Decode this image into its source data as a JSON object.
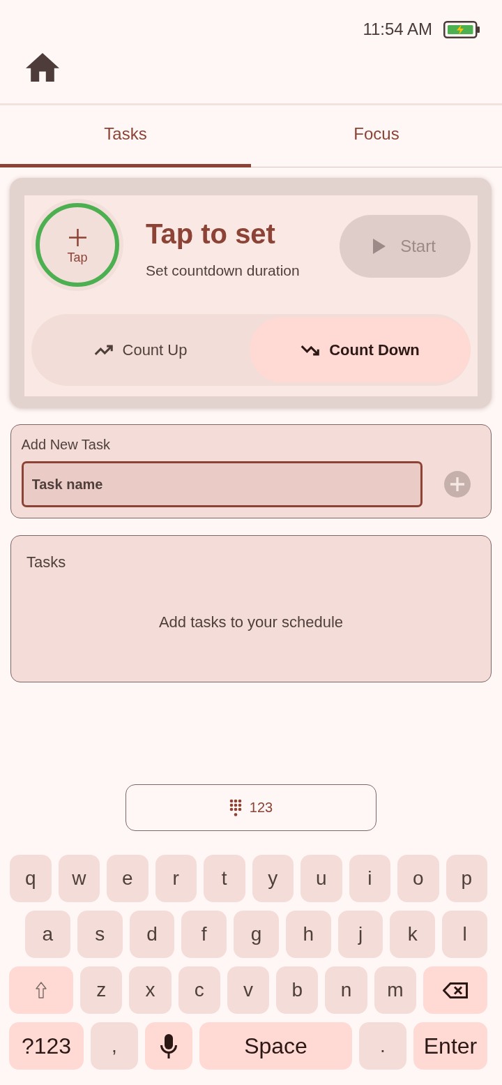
{
  "status_bar": {
    "time": "11:54 AM"
  },
  "tabs": [
    {
      "label": "Tasks",
      "selected": true
    },
    {
      "label": "Focus",
      "selected": false
    }
  ],
  "timer": {
    "dial_label": "Tap",
    "title": "Tap to set",
    "subtitle": "Set countdown duration",
    "start_button": {
      "label": "Start",
      "disabled": true
    },
    "modes": [
      {
        "label": "Count Up",
        "kind": "up",
        "selected": false
      },
      {
        "label": "Count Down",
        "kind": "down",
        "selected": true
      }
    ]
  },
  "add_task": {
    "title": "Add New Task",
    "field": {
      "placeholder": "Task name"
    },
    "add_button": {
      "disabled": true
    }
  },
  "task_list": {
    "title": "Tasks",
    "empty_message": "Add tasks to your schedule"
  },
  "keyboard": {
    "mode_button": {
      "label": "123"
    },
    "key_rows": [
      {
        "keys": [
          {
            "kind": "char",
            "label": "q"
          },
          {
            "kind": "char",
            "label": "w"
          },
          {
            "kind": "char",
            "label": "e"
          },
          {
            "kind": "char",
            "label": "r"
          },
          {
            "kind": "char",
            "label": "t"
          },
          {
            "kind": "char",
            "label": "y"
          },
          {
            "kind": "char",
            "label": "u"
          },
          {
            "kind": "char",
            "label": "i"
          },
          {
            "kind": "char",
            "label": "o"
          },
          {
            "kind": "char",
            "label": "p"
          }
        ]
      },
      {
        "keys": [
          {
            "kind": "char",
            "label": "a"
          },
          {
            "kind": "char",
            "label": "s"
          },
          {
            "kind": "char",
            "label": "d"
          },
          {
            "kind": "char",
            "label": "f"
          },
          {
            "kind": "char",
            "label": "g"
          },
          {
            "kind": "char",
            "label": "h"
          },
          {
            "kind": "char",
            "label": "j"
          },
          {
            "kind": "char",
            "label": "k"
          },
          {
            "kind": "char",
            "label": "l"
          }
        ]
      },
      {
        "keys": [
          {
            "kind": "shift"
          },
          {
            "kind": "char",
            "label": "z"
          },
          {
            "kind": "char",
            "label": "x"
          },
          {
            "kind": "char",
            "label": "c"
          },
          {
            "kind": "char",
            "label": "v"
          },
          {
            "kind": "char",
            "label": "b"
          },
          {
            "kind": "char",
            "label": "n"
          },
          {
            "kind": "char",
            "label": "m"
          },
          {
            "kind": "backspace"
          }
        ]
      },
      {
        "keys": [
          {
            "kind": "symbols",
            "label": "?123"
          },
          {
            "kind": "punct",
            "label": ","
          },
          {
            "kind": "mic"
          },
          {
            "kind": "space",
            "label": "Space"
          },
          {
            "kind": "punct",
            "label": "."
          },
          {
            "kind": "enter",
            "label": "Enter"
          }
        ]
      }
    ]
  }
}
